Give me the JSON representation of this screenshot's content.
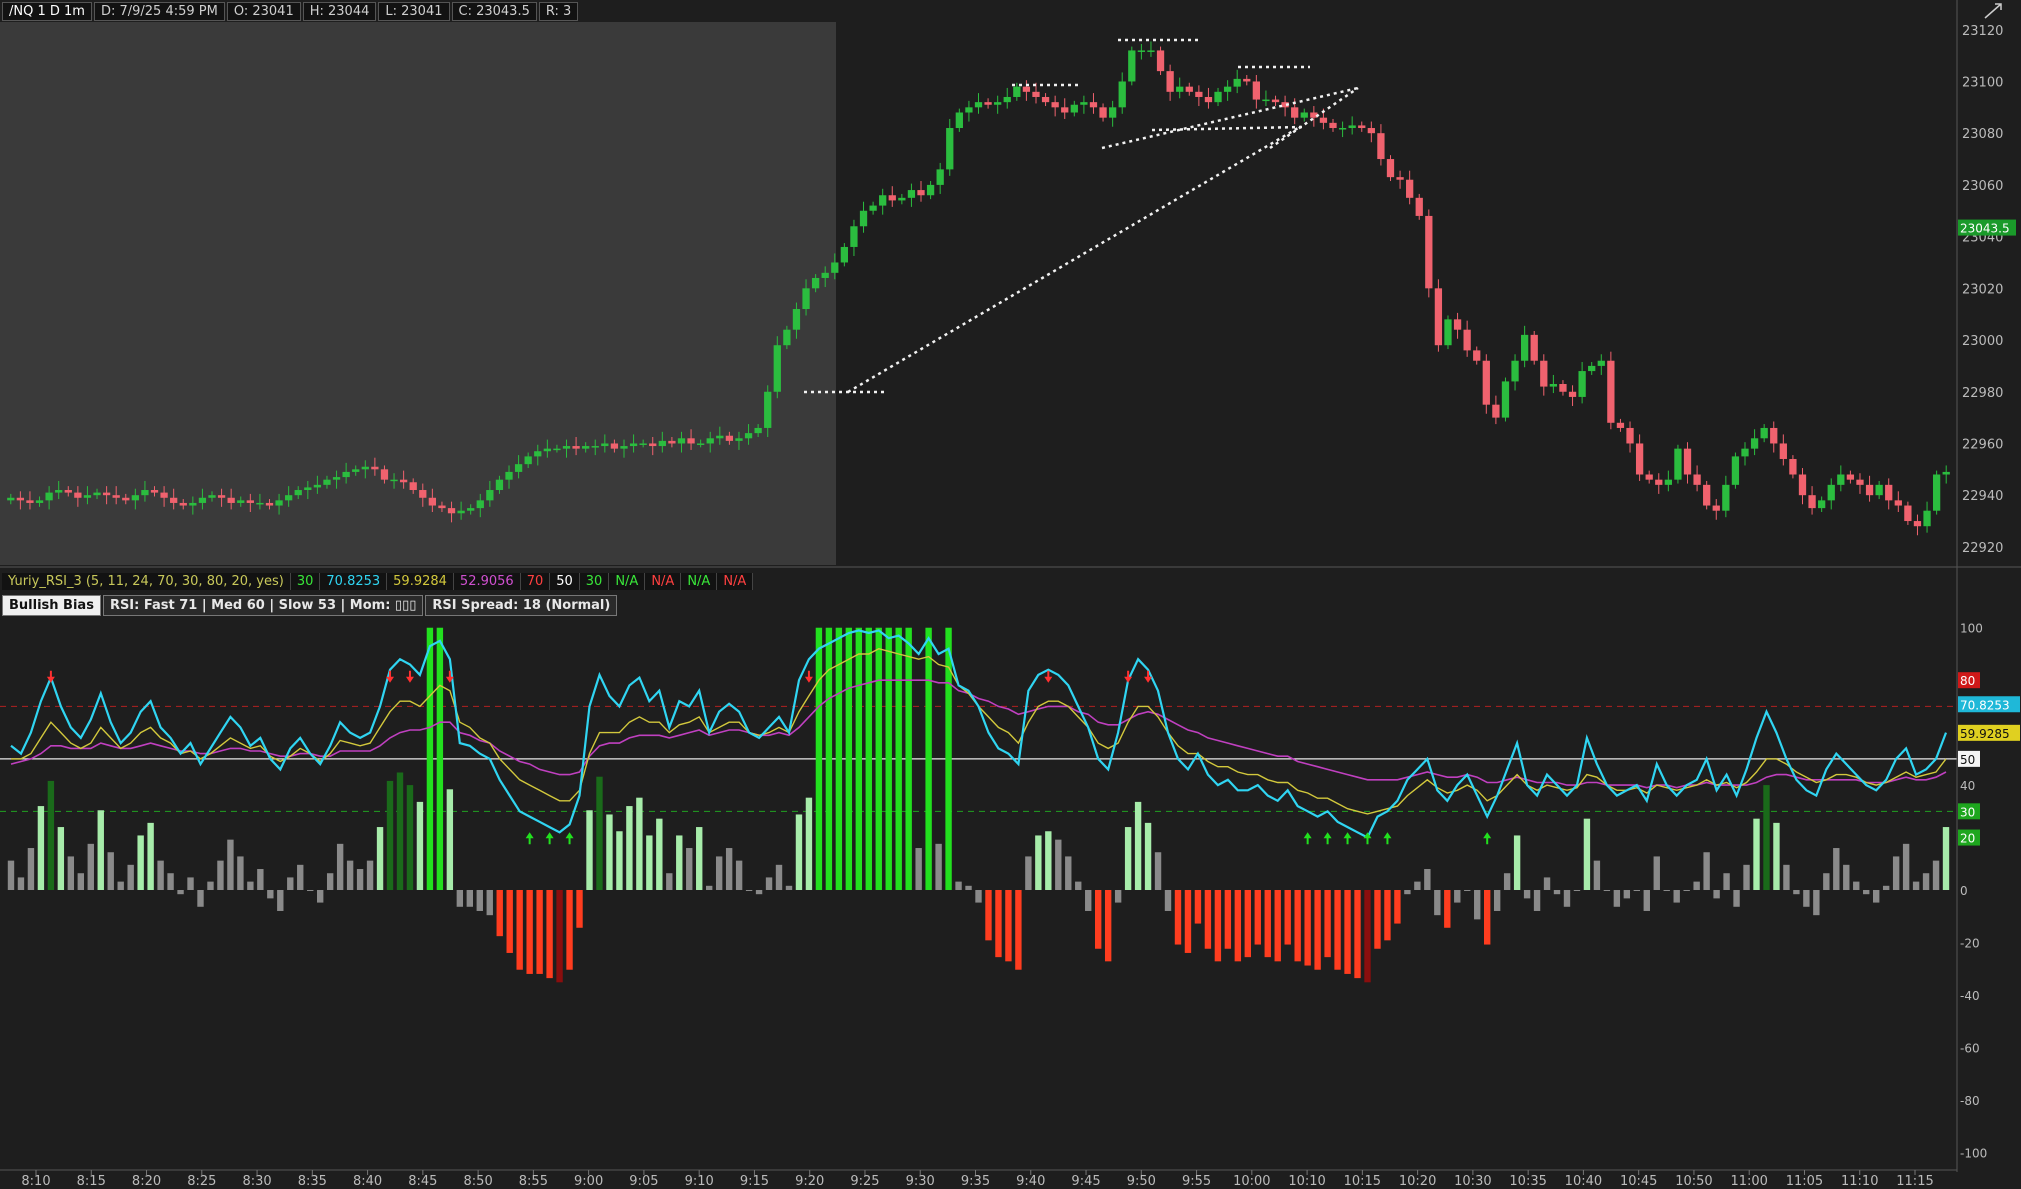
{
  "price_header": {
    "symbol": "/NQ 1 D 1m",
    "date": "D: 7/9/25 4:59 PM",
    "open": "O: 23041",
    "high": "H: 23044",
    "low": "L: 23041",
    "close": "C: 23043.5",
    "range": "R: 3"
  },
  "study_header": {
    "name": "Yuriy_RSI_3 (5, 11, 24, 70, 30, 80, 20, yes)",
    "v1": "30",
    "v2": "70.8253",
    "v3": "59.9284",
    "v4": "52.9056",
    "v5": "70",
    "v6": "50",
    "v7": "30",
    "na1": "N/A",
    "na2": "N/A",
    "na3": "N/A",
    "na4": "N/A"
  },
  "badges": {
    "bias": "Bullish Bias",
    "rsi_summary": "RSI: Fast 71 | Med 60 | Slow 53 | Mom: ▯▯▯",
    "spread": "RSI Spread: 18 (Normal)"
  },
  "colors": {
    "bg": "#1e1e1e",
    "premarket_bg": "#3a3a3a",
    "up": "#2bbd3f",
    "down": "#f0626e",
    "fast": "#30d5f2",
    "med": "#d2c83c",
    "slow": "#c040c0",
    "hist_bright_green": "#22e01e",
    "hist_pale_green": "#a7ecaa",
    "hist_dark_green": "#1a6a1a",
    "hist_gray": "#8a8a8a",
    "hist_orange_red": "#ff3d1f",
    "hist_dark_red": "#8a0e0e",
    "hist_red": "#d01818"
  },
  "chart_data": [
    {
      "type": "candlestick",
      "title": "/NQ 1 D 1m",
      "y_axis_ticks": [
        23120,
        23100,
        23080,
        23060,
        23040,
        23020,
        23000,
        22980,
        22960,
        22940,
        22920
      ],
      "y_axis_ticks_text": [
        "23120",
        "23100",
        "23080",
        "23060",
        "23040",
        "23020",
        "23000",
        "22980",
        "22960",
        "22940",
        "22920"
      ],
      "ylim": [
        22913,
        23123
      ],
      "last_price": "23043.5",
      "x_ticks": [
        "8:10",
        "8:15",
        "8:20",
        "8:25",
        "8:30",
        "8:35",
        "8:40",
        "8:45",
        "8:50",
        "8:55",
        "9:00",
        "9:05",
        "9:10",
        "9:15",
        "9:20",
        "9:25",
        "9:30",
        "9:35",
        "9:40",
        "9:45",
        "9:50",
        "9:55",
        "10:00",
        "10:10",
        "10:15",
        "10:20",
        "10:30",
        "10:35",
        "10:40",
        "10:45",
        "10:50",
        "11:00",
        "11:05",
        "11:10",
        "11:15"
      ],
      "closes": [
        22939,
        22938,
        22937,
        22938,
        22941,
        22942,
        22941,
        22939,
        22940,
        22941,
        22940,
        22939,
        22938,
        22940,
        22942,
        22941,
        22939,
        22937,
        22936,
        22937,
        22939,
        22940,
        22939,
        22937,
        22938,
        22937,
        22937,
        22936,
        22938,
        22940,
        22942,
        22943,
        22944,
        22946,
        22947,
        22949,
        22950,
        22951,
        22950,
        22946,
        22946,
        22945,
        22942,
        22939,
        22936,
        22935,
        22933,
        22934,
        22935,
        22938,
        22942,
        22946,
        22949,
        22952,
        22955,
        22957,
        22958,
        22958,
        22959,
        22958,
        22959,
        22959,
        22960,
        22958,
        22959,
        22960,
        22960,
        22959,
        22961,
        22960,
        22962,
        22960,
        22960,
        22962,
        22963,
        22961,
        22962,
        22964,
        22966,
        22980,
        22998,
        23004,
        23012,
        23020,
        23024,
        23026,
        23030,
        23036,
        23044,
        23050,
        23052,
        23056,
        23054,
        23055,
        23058,
        23056,
        23060,
        23066,
        23082,
        23088,
        23090,
        23092,
        23091,
        23092,
        23094,
        23098,
        23096,
        23094,
        23092,
        23090,
        23088,
        23091,
        23092,
        23090,
        23086,
        23090,
        23100,
        23112,
        23112,
        23112,
        23104,
        23096,
        23098,
        23096,
        23094,
        23092,
        23096,
        23098,
        23101,
        23100,
        23093,
        23093,
        23092,
        23090,
        23086,
        23088,
        23086,
        23084,
        23082,
        23082,
        23083,
        23082,
        23080,
        23070,
        23063,
        23062,
        23055,
        23048,
        23020,
        22998,
        23008,
        23004,
        22996,
        22992,
        22975,
        22970,
        22984,
        22992,
        23002,
        22992,
        22982,
        22983,
        22980,
        22978,
        22988,
        22990,
        22992,
        22968,
        22966,
        22960,
        22948,
        22946,
        22944,
        22946,
        22958,
        22948,
        22944,
        22936,
        22934,
        22944,
        22955,
        22958,
        22962,
        22966,
        22960,
        22954,
        22948,
        22940,
        22935,
        22938,
        22944,
        22948,
        22946,
        22944,
        22940,
        22944,
        22938,
        22936,
        22930,
        22928,
        22934,
        22948,
        22949
      ],
      "annotations": "white dotted trendlines and level lines (drawing overlay)"
    },
    {
      "type": "line",
      "title": "Yuriy_RSI_3 (5, 11, 24, 70, 30, 80, 20, yes)",
      "y_axis_ticks": [
        100,
        80,
        70.8253,
        59.9285,
        50,
        40,
        30,
        20,
        0,
        -20,
        -40,
        -60,
        -80,
        -100
      ],
      "y_axis_ticks_text": [
        "100",
        "80",
        "70.8253",
        "59.9285",
        "50",
        "40",
        "30",
        "20",
        "0",
        "-20",
        "-40",
        "-60",
        "-80",
        "-100"
      ],
      "ylim": [
        -106,
        106
      ],
      "levels": {
        "upper_dashed": 70,
        "mid": 50,
        "lower_dashed": 30
      },
      "series": [
        {
          "name": "Fast",
          "color": "#30d5f2"
        },
        {
          "name": "Med",
          "color": "#d2c83c"
        },
        {
          "name": "Slow",
          "color": "#c040c0"
        }
      ],
      "fast": [
        55,
        52,
        60,
        72,
        81,
        70,
        62,
        58,
        65,
        75,
        64,
        56,
        60,
        68,
        72,
        62,
        58,
        52,
        56,
        48,
        54,
        60,
        66,
        62,
        55,
        58,
        50,
        46,
        54,
        58,
        52,
        48,
        55,
        64,
        60,
        58,
        60,
        70,
        84,
        88,
        86,
        82,
        93,
        95,
        88,
        56,
        55,
        52,
        50,
        42,
        36,
        30,
        28,
        26,
        24,
        22,
        25,
        36,
        70,
        82,
        74,
        70,
        78,
        81,
        72,
        76,
        62,
        72,
        70,
        76,
        60,
        68,
        71,
        68,
        60,
        58,
        62,
        66,
        60,
        80,
        88,
        92,
        94,
        96,
        98,
        99,
        98,
        99,
        96,
        97,
        94,
        90,
        96,
        90,
        92,
        78,
        76,
        70,
        60,
        54,
        52,
        48,
        76,
        82,
        84,
        82,
        78,
        70,
        62,
        50,
        46,
        60,
        80,
        88,
        84,
        76,
        60,
        50,
        46,
        52,
        44,
        40,
        42,
        38,
        38,
        40,
        36,
        34,
        38,
        32,
        30,
        28,
        30,
        26,
        24,
        22,
        20,
        28,
        30,
        34,
        42,
        46,
        50,
        38,
        34,
        40,
        44,
        36,
        28,
        36,
        46,
        56,
        40,
        36,
        44,
        40,
        36,
        40,
        58,
        48,
        40,
        36,
        38,
        40,
        34,
        48,
        40,
        36,
        40,
        42,
        50,
        38,
        44,
        36,
        46,
        58,
        68,
        60,
        50,
        42,
        38,
        36,
        46,
        52,
        48,
        44,
        40,
        38,
        42,
        50,
        54,
        44,
        46,
        50,
        60
      ],
      "med": [
        50,
        50,
        52,
        58,
        64,
        60,
        56,
        54,
        56,
        62,
        58,
        54,
        56,
        60,
        62,
        58,
        56,
        52,
        53,
        50,
        52,
        55,
        58,
        56,
        54,
        55,
        51,
        49,
        51,
        54,
        52,
        49,
        52,
        57,
        56,
        55,
        56,
        62,
        68,
        72,
        72,
        70,
        74,
        78,
        76,
        64,
        62,
        58,
        56,
        50,
        46,
        42,
        40,
        38,
        36,
        34,
        34,
        38,
        52,
        60,
        60,
        60,
        64,
        66,
        64,
        64,
        60,
        63,
        64,
        66,
        60,
        62,
        64,
        64,
        60,
        59,
        60,
        62,
        60,
        68,
        74,
        80,
        84,
        86,
        88,
        90,
        90,
        92,
        91,
        90,
        89,
        88,
        89,
        86,
        85,
        78,
        75,
        70,
        66,
        62,
        60,
        56,
        64,
        70,
        72,
        72,
        70,
        66,
        62,
        56,
        54,
        56,
        64,
        70,
        70,
        66,
        60,
        55,
        52,
        52,
        49,
        47,
        47,
        45,
        44,
        44,
        42,
        41,
        41,
        38,
        37,
        35,
        35,
        33,
        31,
        30,
        29,
        30,
        31,
        32,
        36,
        39,
        42,
        39,
        37,
        38,
        40,
        38,
        34,
        36,
        40,
        44,
        40,
        38,
        40,
        39,
        38,
        39,
        44,
        43,
        40,
        38,
        38,
        39,
        37,
        40,
        39,
        38,
        39,
        40,
        42,
        40,
        41,
        39,
        41,
        45,
        50,
        50,
        48,
        45,
        43,
        41,
        42,
        44,
        44,
        43,
        41,
        40,
        41,
        43,
        45,
        43,
        44,
        45,
        50
      ],
      "slow": [
        48,
        49,
        50,
        52,
        55,
        55,
        54,
        54,
        54,
        56,
        55,
        54,
        54,
        55,
        56,
        55,
        54,
        53,
        53,
        52,
        52,
        53,
        54,
        54,
        53,
        53,
        52,
        51,
        51,
        52,
        52,
        51,
        51,
        53,
        53,
        53,
        53,
        55,
        58,
        60,
        61,
        61,
        62,
        64,
        64,
        60,
        59,
        57,
        56,
        53,
        51,
        49,
        48,
        46,
        45,
        44,
        44,
        45,
        51,
        55,
        56,
        56,
        58,
        59,
        59,
        59,
        58,
        59,
        60,
        61,
        59,
        60,
        61,
        61,
        60,
        59,
        59,
        60,
        59,
        62,
        66,
        70,
        73,
        75,
        77,
        78,
        79,
        80,
        80,
        80,
        80,
        80,
        80,
        79,
        79,
        76,
        75,
        73,
        72,
        70,
        69,
        67,
        68,
        69,
        70,
        70,
        70,
        68,
        67,
        64,
        63,
        63,
        65,
        67,
        68,
        67,
        65,
        63,
        61,
        60,
        58,
        57,
        56,
        55,
        54,
        53,
        52,
        51,
        51,
        49,
        48,
        47,
        46,
        45,
        44,
        43,
        42,
        42,
        42,
        42,
        43,
        44,
        45,
        44,
        43,
        43,
        44,
        43,
        41,
        41,
        42,
        43,
        42,
        41,
        41,
        41,
        40,
        40,
        41,
        41,
        40,
        40,
        40,
        40,
        39,
        40,
        40,
        39,
        40,
        40,
        41,
        40,
        40,
        40,
        40,
        41,
        43,
        44,
        44,
        43,
        42,
        42,
        42,
        42,
        42,
        42,
        41,
        41,
        41,
        42,
        43,
        42,
        42,
        43,
        45
      ]
    }
  ]
}
